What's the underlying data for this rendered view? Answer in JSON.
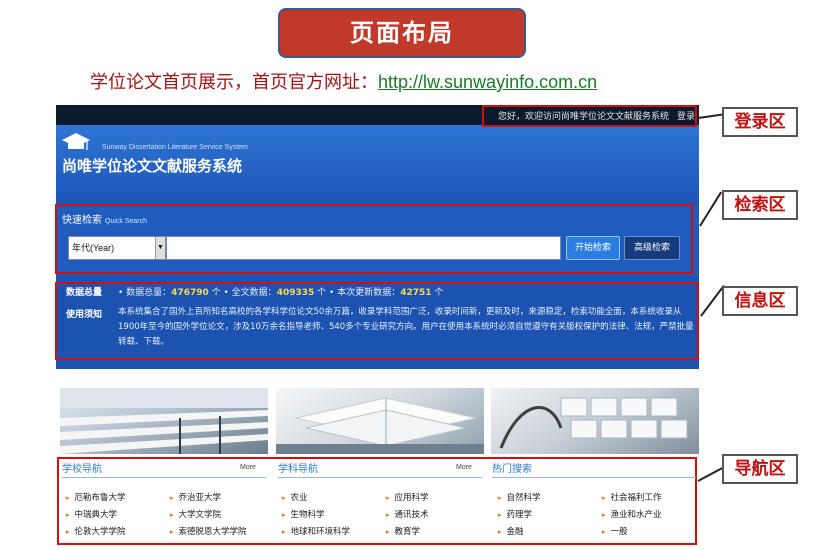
{
  "slide": {
    "title": "页面布局",
    "subtitle_prefix": "学位论文首页展示，首页官方网址：",
    "subtitle_url": "http://lw.sunwayinfo.com.cn"
  },
  "site": {
    "topbar_welcome": "您好，欢迎访问尚唯学位论文文献服务系统",
    "topbar_login": "登录",
    "logo_en": "Sunway Dissertation Literature Service System",
    "logo_cn": "尚唯学位论文文献服务系统",
    "search": {
      "title": "快速检索",
      "title_en": "Quick Search",
      "select_value": "年代(Year)",
      "input_value": "",
      "start_button": "开始检索",
      "advanced_button": "高级检索"
    },
    "info": {
      "stats_label": "数据总量",
      "total_label": "• 数据总量：",
      "total_value": "476790",
      "total_unit": "个",
      "fulltext_label": "• 全文数据：",
      "fulltext_value": "409335",
      "fulltext_unit": "个",
      "update_label": "• 本次更新数据：",
      "update_value": "42751",
      "update_unit": "个",
      "notice_label": "使用须知",
      "notice_text": "本系统集合了国外上百所知名高校的各学科学位论文50余万篇，收录学科范围广泛，收录时间新，更新及时，来源稳定，检索功能全面，本系统收录从1900年至今的国外学位论文，涉及10万余名指导老师、540多个专业研究方向。用户在使用本系统时必须自觉遵守有关版权保护的法律、法规，严禁批量转载、下载。"
    },
    "nav": {
      "school": {
        "title": "学校导航",
        "more": "More",
        "items": [
          "厄勒布鲁大学",
          "乔治亚大学",
          "中瑞典大学",
          "大学文学院",
          "伦敦大学学院",
          "索德脱恩大学学院"
        ]
      },
      "subject": {
        "title": "学科导航",
        "more": "More",
        "items": [
          "农业",
          "应用科学",
          "生物科学",
          "通讯技术",
          "地球和环境科学",
          "教育学"
        ]
      },
      "hot": {
        "title": "热门搜索",
        "items": [
          "自然科学",
          "社会福利工作",
          "药理学",
          "渔业和水产业",
          "金融",
          "一般"
        ]
      }
    }
  },
  "callouts": {
    "login": "登录区",
    "search": "检索区",
    "info": "信息区",
    "nav": "导航区"
  },
  "colors": {
    "title_bg": "#c0392b",
    "site_blue": "#1e56b4",
    "highlight_red": "#d01010",
    "stat_yellow": "#ffd84a"
  }
}
